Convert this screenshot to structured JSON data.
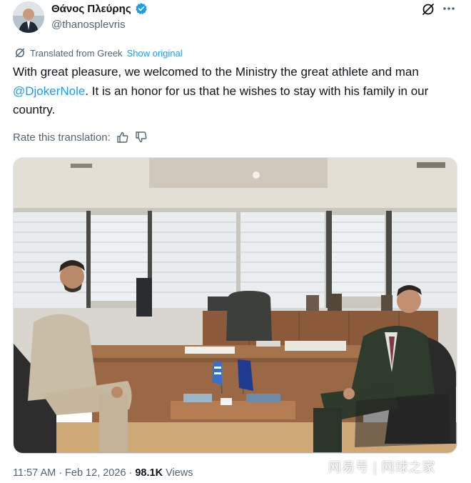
{
  "author": {
    "display_name": "Θάνος Πλεύρης",
    "handle": "@thanosplevris",
    "verified_color": "#1d9bf0"
  },
  "header": {
    "grok_icon": "grok-icon",
    "more_icon": "more-icon"
  },
  "translation": {
    "translated_label": "Translated from Greek",
    "show_original": "Show original",
    "rate_label": "Rate this translation:"
  },
  "tweet": {
    "text_part1": "With great pleasure, we welcomed to the Ministry the great athlete and man ",
    "mention": "@DjokerNole",
    "text_part2": ". It is an honor for us that he wishes to stay with his family in our country."
  },
  "meta": {
    "time": "11:57 AM",
    "separator": "·",
    "date": "Feb 12, 2026",
    "views_count": "98.1K",
    "views_label": "Views"
  },
  "watermark": {
    "text": "网易号 | 网球之家"
  },
  "colors": {
    "accent": "#1d9bf0",
    "secondary_text": "#536471",
    "primary_text": "#0f1419"
  }
}
